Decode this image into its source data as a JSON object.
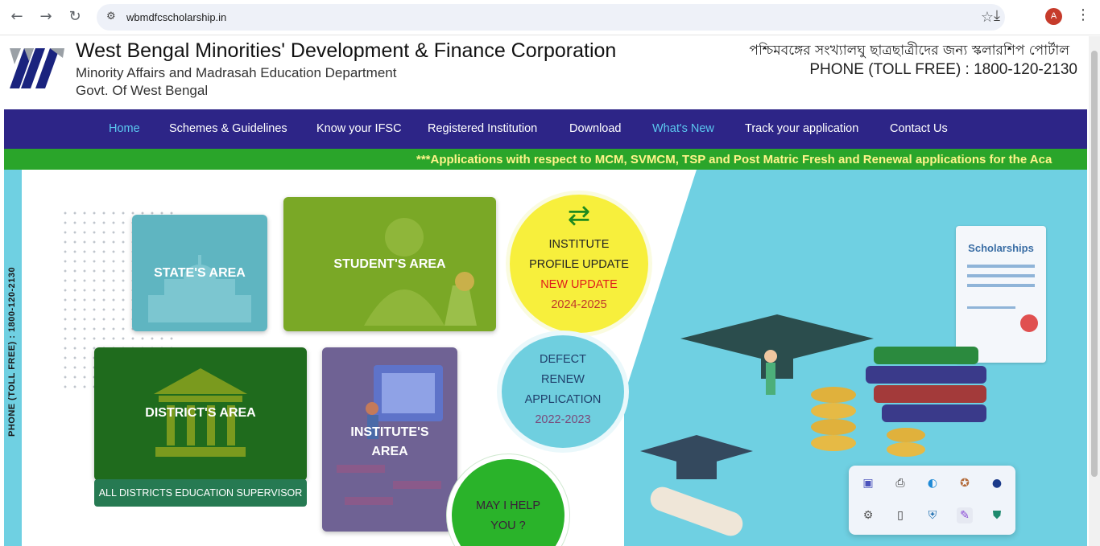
{
  "browser": {
    "url": "wbmdfcscholarship.in",
    "avatar_letter": "A"
  },
  "header": {
    "title": "West Bengal Minorities' Development & Finance Corporation",
    "subtitle": "Minority Affairs and Madrasah Education Department",
    "govt": "Govt. Of West Bengal",
    "bengali_tagline": "পশ্চিমবঙ্গের সংখ্যালঘু ছাত্রছাত্রীদের জন্য স্কলারশিপ পোর্টাল",
    "tollfree": "PHONE (TOLL FREE) : 1800-120-2130"
  },
  "nav": {
    "items": [
      {
        "label": "Home"
      },
      {
        "label": "Schemes & Guidelines"
      },
      {
        "label": "Know your IFSC"
      },
      {
        "label": "Registered Institution"
      },
      {
        "label": "Download"
      },
      {
        "label": "What's New"
      },
      {
        "label": "Track your application"
      },
      {
        "label": "Contact Us"
      }
    ]
  },
  "marquee": "***Applications with respect to MCM, SVMCM, TSP and Post Matric Fresh and Renewal applications for the Aca",
  "side_phone": "PHONE (TOLL FREE) : 1800-120-2130",
  "tiles": {
    "state": "STATE'S AREA",
    "student": "STUDENT'S AREA",
    "district": "DISTRICT'S AREA",
    "institute_line1": "INSTITUTE'S",
    "institute_line2": "AREA",
    "all_districts": "ALL DISTRICTS EDUCATION SUPERVISOR"
  },
  "circles": {
    "profile": {
      "l1": "INSTITUTE",
      "l2": "PROFILE UPDATE",
      "l3": "NEW UPDATE",
      "l4": "2024-2025"
    },
    "defect": {
      "l1": "DEFECT",
      "l2": "RENEW",
      "l3": "APPLICATION",
      "l4": "2022-2023"
    },
    "help": {
      "l1": "MAY I HELP",
      "l2": "YOU ?"
    }
  },
  "illustration": {
    "scholarships_label": "Scholarships"
  },
  "colors": {
    "nav_bg": "#2d2587",
    "marquee_bg": "#2aa52a",
    "accent_cyan": "#6fd0e2"
  }
}
